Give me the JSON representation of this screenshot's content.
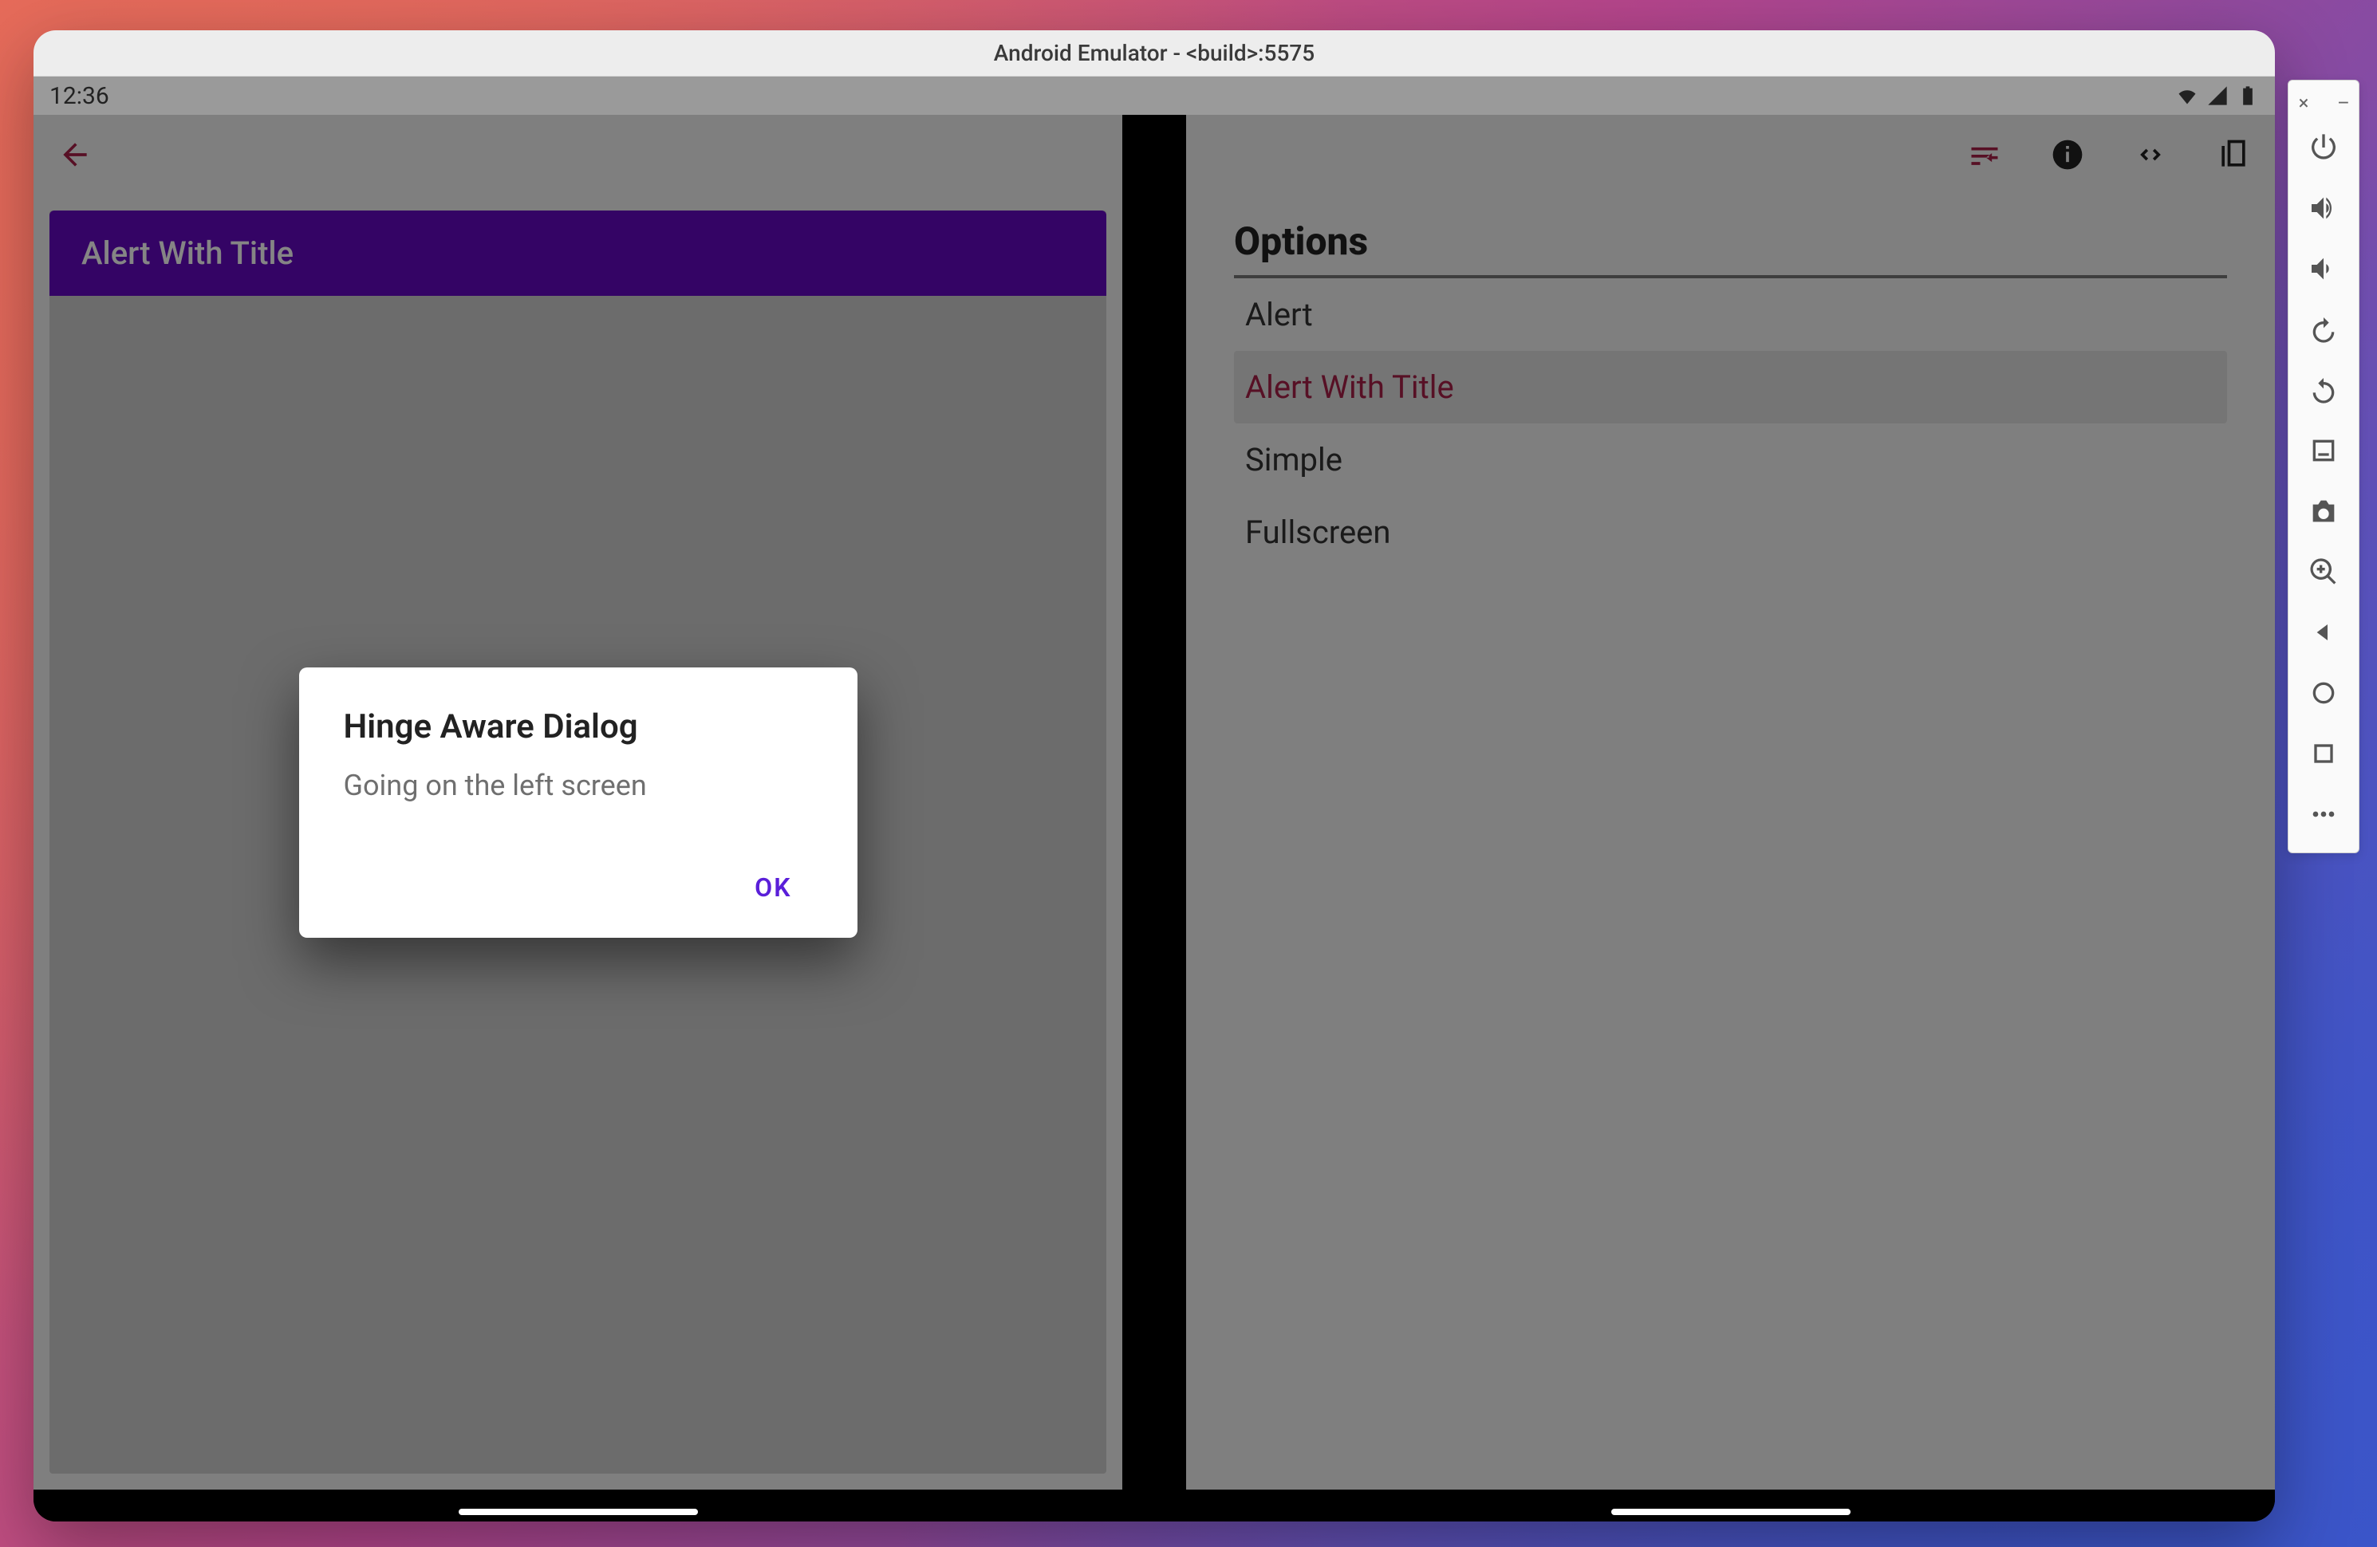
{
  "emulator": {
    "window_title": "Android Emulator - <build>:5575"
  },
  "status_bar": {
    "time": "12:36"
  },
  "left_pane": {
    "toolbar_title": "Alert With Title"
  },
  "dialog": {
    "title": "Hinge Aware Dialog",
    "body": "Going on the left screen",
    "ok_label": "OK"
  },
  "right_pane": {
    "title": "Options",
    "items": [
      {
        "label": "Alert",
        "selected": false
      },
      {
        "label": "Alert With Title",
        "selected": true
      },
      {
        "label": "Simple",
        "selected": false
      },
      {
        "label": "Fullscreen",
        "selected": false
      }
    ]
  },
  "side_toolbar": {
    "close": "×",
    "minimize": "–"
  }
}
